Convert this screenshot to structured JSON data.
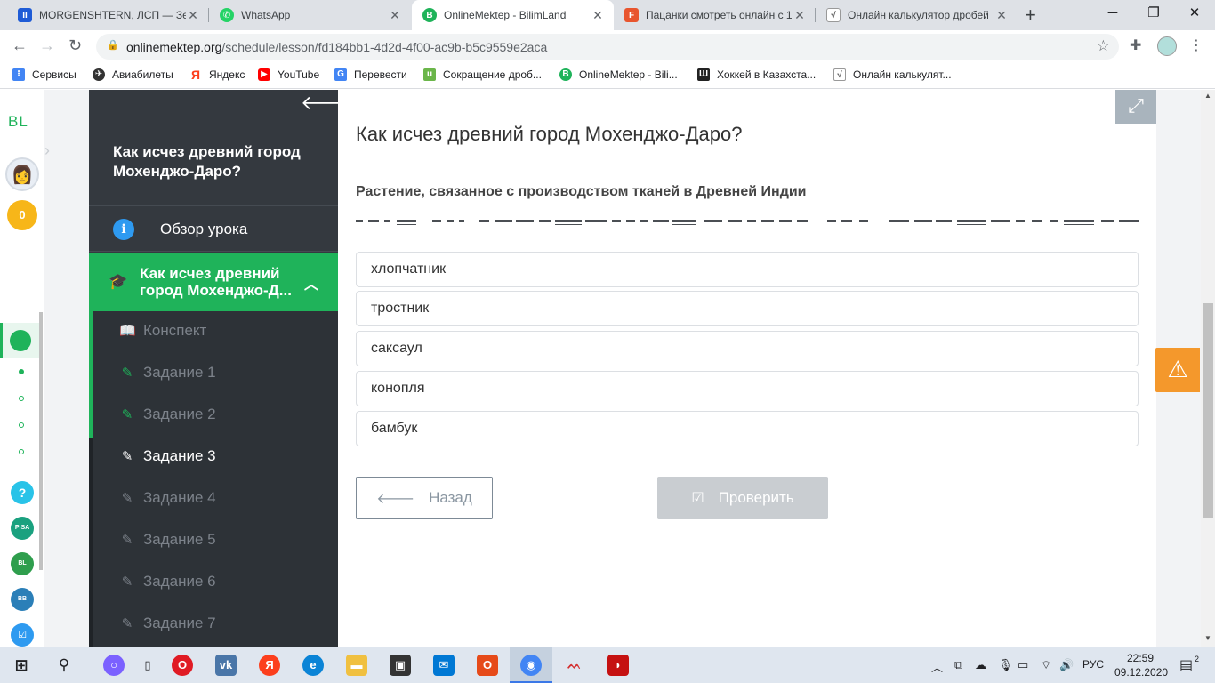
{
  "browser": {
    "tabs": [
      {
        "title": "MORGENSHTERN, ЛСП — Зел",
        "icon": "music-icon",
        "color": "#1e5bd6"
      },
      {
        "title": "WhatsApp",
        "icon": "whatsapp-icon",
        "color": "#25d366"
      },
      {
        "title": "OnlineMektep - BilimLand",
        "icon": "onlinemektep-icon",
        "color": "#1fb35a"
      },
      {
        "title": "Пацанки смотреть онлайн с 1",
        "icon": "video-icon",
        "color": "#e8552e"
      },
      {
        "title": "Онлайн калькулятор дробей",
        "icon": "calculator-icon",
        "color": "#555555"
      }
    ],
    "url_host": "onlinemektep.org",
    "url_path": "/schedule/lesson/fd184bb1-4d2d-4f00-ac9b-b5c9559e2aca",
    "bookmarks": [
      {
        "label": "Сервисы",
        "icon": "apps-icon",
        "color": "#4285f4"
      },
      {
        "label": "Авиабилеты",
        "icon": "plane-icon",
        "color": "#333333"
      },
      {
        "label": "Яндекс",
        "icon": "yandex-icon",
        "color": "#fc3f1d"
      },
      {
        "label": "YouTube",
        "icon": "youtube-icon",
        "color": "#ff0000"
      },
      {
        "label": "Перевести",
        "icon": "translate-icon",
        "color": "#4285f4"
      },
      {
        "label": "Сокращение дроб...",
        "icon": "u-icon",
        "color": "#6bb64a"
      },
      {
        "label": "OnlineMektep - Bili...",
        "icon": "onlinemektep-icon",
        "color": "#1fb35a"
      },
      {
        "label": "Хоккей в Казахста...",
        "icon": "sh-icon",
        "color": "#222222"
      },
      {
        "label": "Онлайн калькулят...",
        "icon": "calculator-icon",
        "color": "#555555"
      }
    ]
  },
  "leftbar": {
    "logo": "BL",
    "coins": "0"
  },
  "sidebar": {
    "lesson_title": "Как исчез древний город Мохенджо-Даро?",
    "overview": "Обзор урока",
    "section": "Как исчез древний город Мохенджо-Д...",
    "items": [
      {
        "label": "Конспект",
        "state": "done"
      },
      {
        "label": "Задание 1",
        "state": "done"
      },
      {
        "label": "Задание 2",
        "state": "done"
      },
      {
        "label": "Задание 3",
        "state": "current"
      },
      {
        "label": "Задание 4",
        "state": "todo"
      },
      {
        "label": "Задание 5",
        "state": "todo"
      },
      {
        "label": "Задание 6",
        "state": "todo"
      },
      {
        "label": "Задание 7",
        "state": "todo"
      }
    ]
  },
  "task": {
    "title": "Как исчез древний город Мохенджо-Даро?",
    "question": "Растение, связанное с производством тканей в Древней Индии",
    "options": [
      "хлопчатник",
      "тростник",
      "саксаул",
      "конопля",
      "бамбук"
    ],
    "back_label": "Назад",
    "check_label": "Проверить"
  },
  "taskbar": {
    "lang": "РУС",
    "time": "22:59",
    "date": "09.12.2020",
    "notifications": "2"
  }
}
